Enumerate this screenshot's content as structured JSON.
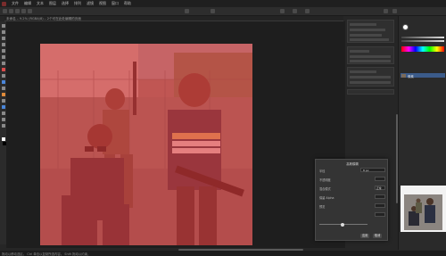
{
  "menubar": {
    "items": [
      "文件",
      "编辑",
      "文本",
      "图层",
      "选择",
      "排列",
      "滤镜",
      "视图",
      "窗口",
      "帮助"
    ]
  },
  "document": {
    "tab_title": "未命名 – 9.2% (RGBA/8) – 2个可在此处编辑的页面"
  },
  "right_panel": {
    "layer_name": "像素"
  },
  "dialog": {
    "title": "高斯模糊",
    "radius_label": "半径",
    "radius_value": "8 px",
    "opacity_label": "不透明度",
    "blend_label": "混合模式",
    "blend_value": "正常",
    "preserve_label": "保留 Alpha",
    "preview_label": "预览",
    "apply_label": "应用",
    "cancel_label": "取消"
  },
  "statusbar": {
    "text": "拖动以移动选区。 Ctrl 单击以复制所选内容。 Shift 拖动以约束。"
  },
  "colors": {
    "accent": "#3b5b8a",
    "overlay": "#e53b3b"
  }
}
